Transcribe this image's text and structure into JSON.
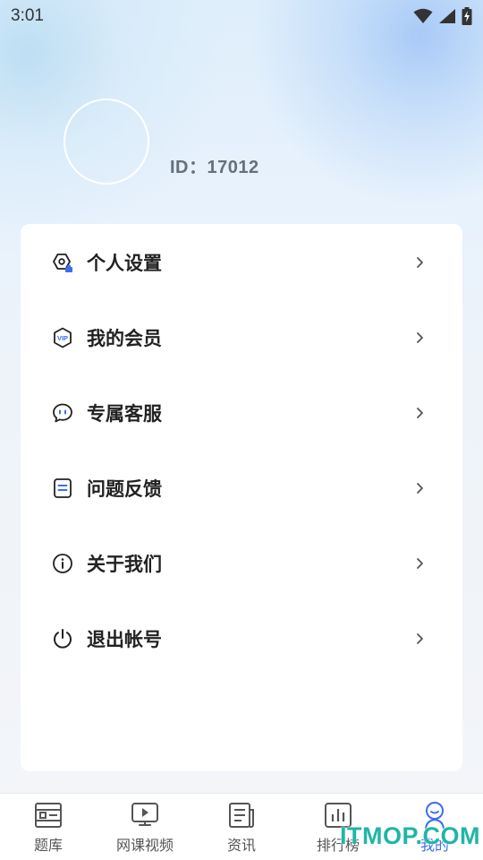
{
  "status_bar": {
    "time": "3:01",
    "icons": [
      "wifi-icon",
      "signal-icon",
      "battery-charging-icon"
    ]
  },
  "profile": {
    "id_text": "ID：17012"
  },
  "menu": {
    "items": [
      {
        "label": "个人设置",
        "icon": "settings-hexagon-icon"
      },
      {
        "label": "我的会员",
        "icon": "vip-shield-icon"
      },
      {
        "label": "专属客服",
        "icon": "chat-bubble-icon"
      },
      {
        "label": "问题反馈",
        "icon": "feedback-note-icon"
      },
      {
        "label": "关于我们",
        "icon": "info-icon"
      },
      {
        "label": "退出帐号",
        "icon": "power-icon"
      }
    ]
  },
  "tabbar": {
    "tabs": [
      {
        "label": "题库",
        "icon": "question-bank-icon"
      },
      {
        "label": "网课视频",
        "icon": "video-course-icon"
      },
      {
        "label": "资讯",
        "icon": "news-icon"
      },
      {
        "label": "排行榜",
        "icon": "ranking-icon"
      },
      {
        "label": "我的",
        "icon": "profile-icon",
        "active": true
      }
    ]
  },
  "watermark": "ITMOP.COM",
  "colors": {
    "accent": "#3a6df0",
    "text_primary": "#222222",
    "watermark": "#1fb6a6"
  }
}
